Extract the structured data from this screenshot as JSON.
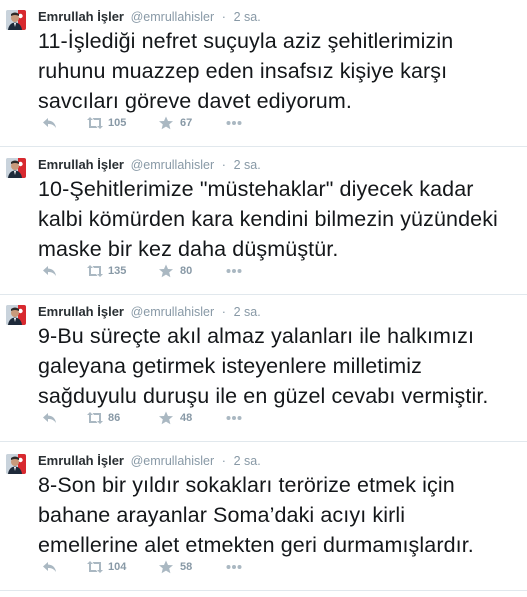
{
  "tweets": [
    {
      "author_name": "Emrullah İşler",
      "handle": "@emrullahisler",
      "separator": "·",
      "time": "2 sa.",
      "text": "11-İşlediği nefret suçuyla aziz şehitlerimizin ruhunu muazzep eden insafsız kişiye karşı savcıları göreve davet ediyorum.",
      "retweets": "105",
      "favorites": "67"
    },
    {
      "author_name": "Emrullah İşler",
      "handle": "@emrullahisler",
      "separator": "·",
      "time": "2 sa.",
      "text": "10-Şehitlerimize \"müstehaklar\" diyecek kadar kalbi kömürden kara kendini bilmezin yüzündeki maske bir kez daha düşmüştür.",
      "retweets": "135",
      "favorites": "80"
    },
    {
      "author_name": "Emrullah İşler",
      "handle": "@emrullahisler",
      "separator": "·",
      "time": "2 sa.",
      "text": "9-Bu süreçte akıl almaz yalanları ile halkımızı galeyana getirmek isteyenlere milletimiz sağduyulu duruşu ile en güzel cevabı vermiştir.",
      "retweets": "86",
      "favorites": "48"
    },
    {
      "author_name": "Emrullah İşler",
      "handle": "@emrullahisler",
      "separator": "·",
      "time": "2 sa.",
      "text": "8-Son bir yıldır sokakları terörize etmek için bahane arayanlar Soma’daki acıyı kirli emellerine alet etmekten geri durmamışlardır.",
      "retweets": "104",
      "favorites": "58"
    }
  ],
  "icons": {
    "reply": "reply-icon",
    "retweet": "retweet-icon",
    "favorite": "star-icon",
    "more": "more-icon"
  },
  "colors": {
    "name": "#292f33",
    "meta": "#8899a6",
    "text": "#14171a",
    "divider": "#e1e8ed",
    "icon": "#aab8c2"
  }
}
